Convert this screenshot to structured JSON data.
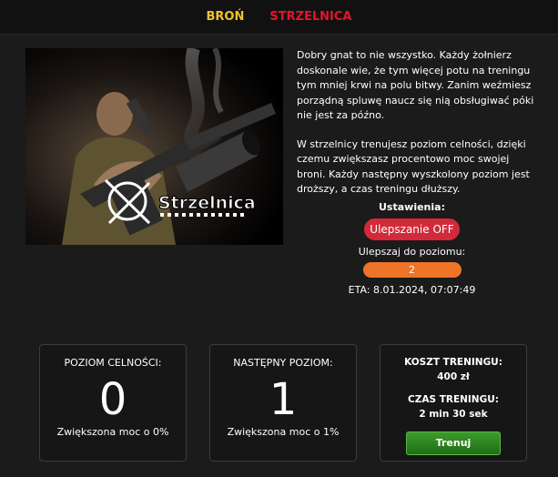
{
  "nav": {
    "tab_weapon": "BROŃ",
    "tab_range": "STRZELNICA"
  },
  "hero": {
    "logo_text": "Strzelnica"
  },
  "description": {
    "p1": "Dobry gnat to nie wszystko. Każdy żołnierz doskonale wie, że tym więcej potu na treningu tym mniej krwi na polu bitwy. Zanim weźmiesz porządną spluwę naucz się nią obsługiwać póki nie jest za późno.",
    "p2": "W strzelnicy trenujesz poziom celności, dzięki czemu zwiększasz procentowo moc swojej broni. Każdy następny wyszkolony poziom jest droższy, a czas treningu dłuższy."
  },
  "settings": {
    "title": "Ustawienia:",
    "upgrade_button": "Ulepszanie OFF",
    "upgrade_to_label": "Ulepszaj do poziomu:",
    "upgrade_to_value": "2",
    "eta": "ETA: 8.01.2024, 07:07:49"
  },
  "cards": {
    "accuracy": {
      "label": "POZIOM CELNOŚCI:",
      "value": "0",
      "bonus": "Zwiększona moc o 0%"
    },
    "next": {
      "label": "NASTĘPNY POZIOM:",
      "value": "1",
      "bonus": "Zwiększona moc o 1%"
    },
    "training": {
      "cost_label": "KOSZT TRENINGU:",
      "cost_value": "400 zł",
      "time_label": "CZAS TRENINGU:",
      "time_value": "2 min 30 sek",
      "train_button": "Trenuj"
    }
  },
  "colors": {
    "tab_active": "#f2c22b",
    "tab_range": "#e3142b",
    "upgrade_off": "#d22a3a",
    "level_select": "#ef7428",
    "train_button": "#2f8a22"
  }
}
